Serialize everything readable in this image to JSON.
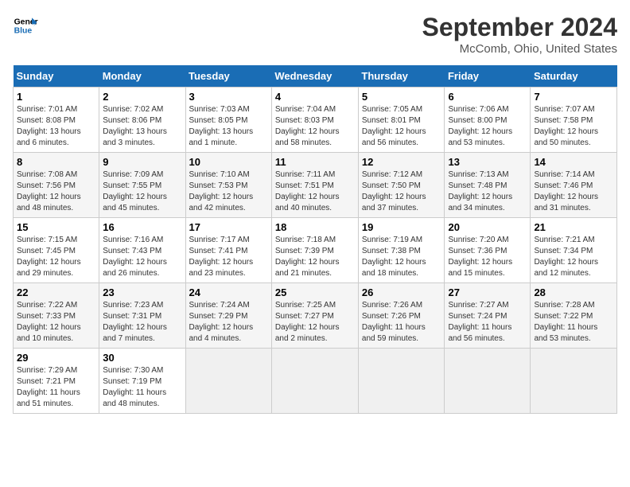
{
  "header": {
    "logo_line1": "General",
    "logo_line2": "Blue",
    "month": "September 2024",
    "location": "McComb, Ohio, United States"
  },
  "weekdays": [
    "Sunday",
    "Monday",
    "Tuesday",
    "Wednesday",
    "Thursday",
    "Friday",
    "Saturday"
  ],
  "weeks": [
    [
      {
        "day": "1",
        "info": "Sunrise: 7:01 AM\nSunset: 8:08 PM\nDaylight: 13 hours\nand 6 minutes."
      },
      {
        "day": "2",
        "info": "Sunrise: 7:02 AM\nSunset: 8:06 PM\nDaylight: 13 hours\nand 3 minutes."
      },
      {
        "day": "3",
        "info": "Sunrise: 7:03 AM\nSunset: 8:05 PM\nDaylight: 13 hours\nand 1 minute."
      },
      {
        "day": "4",
        "info": "Sunrise: 7:04 AM\nSunset: 8:03 PM\nDaylight: 12 hours\nand 58 minutes."
      },
      {
        "day": "5",
        "info": "Sunrise: 7:05 AM\nSunset: 8:01 PM\nDaylight: 12 hours\nand 56 minutes."
      },
      {
        "day": "6",
        "info": "Sunrise: 7:06 AM\nSunset: 8:00 PM\nDaylight: 12 hours\nand 53 minutes."
      },
      {
        "day": "7",
        "info": "Sunrise: 7:07 AM\nSunset: 7:58 PM\nDaylight: 12 hours\nand 50 minutes."
      }
    ],
    [
      {
        "day": "8",
        "info": "Sunrise: 7:08 AM\nSunset: 7:56 PM\nDaylight: 12 hours\nand 48 minutes."
      },
      {
        "day": "9",
        "info": "Sunrise: 7:09 AM\nSunset: 7:55 PM\nDaylight: 12 hours\nand 45 minutes."
      },
      {
        "day": "10",
        "info": "Sunrise: 7:10 AM\nSunset: 7:53 PM\nDaylight: 12 hours\nand 42 minutes."
      },
      {
        "day": "11",
        "info": "Sunrise: 7:11 AM\nSunset: 7:51 PM\nDaylight: 12 hours\nand 40 minutes."
      },
      {
        "day": "12",
        "info": "Sunrise: 7:12 AM\nSunset: 7:50 PM\nDaylight: 12 hours\nand 37 minutes."
      },
      {
        "day": "13",
        "info": "Sunrise: 7:13 AM\nSunset: 7:48 PM\nDaylight: 12 hours\nand 34 minutes."
      },
      {
        "day": "14",
        "info": "Sunrise: 7:14 AM\nSunset: 7:46 PM\nDaylight: 12 hours\nand 31 minutes."
      }
    ],
    [
      {
        "day": "15",
        "info": "Sunrise: 7:15 AM\nSunset: 7:45 PM\nDaylight: 12 hours\nand 29 minutes."
      },
      {
        "day": "16",
        "info": "Sunrise: 7:16 AM\nSunset: 7:43 PM\nDaylight: 12 hours\nand 26 minutes."
      },
      {
        "day": "17",
        "info": "Sunrise: 7:17 AM\nSunset: 7:41 PM\nDaylight: 12 hours\nand 23 minutes."
      },
      {
        "day": "18",
        "info": "Sunrise: 7:18 AM\nSunset: 7:39 PM\nDaylight: 12 hours\nand 21 minutes."
      },
      {
        "day": "19",
        "info": "Sunrise: 7:19 AM\nSunset: 7:38 PM\nDaylight: 12 hours\nand 18 minutes."
      },
      {
        "day": "20",
        "info": "Sunrise: 7:20 AM\nSunset: 7:36 PM\nDaylight: 12 hours\nand 15 minutes."
      },
      {
        "day": "21",
        "info": "Sunrise: 7:21 AM\nSunset: 7:34 PM\nDaylight: 12 hours\nand 12 minutes."
      }
    ],
    [
      {
        "day": "22",
        "info": "Sunrise: 7:22 AM\nSunset: 7:33 PM\nDaylight: 12 hours\nand 10 minutes."
      },
      {
        "day": "23",
        "info": "Sunrise: 7:23 AM\nSunset: 7:31 PM\nDaylight: 12 hours\nand 7 minutes."
      },
      {
        "day": "24",
        "info": "Sunrise: 7:24 AM\nSunset: 7:29 PM\nDaylight: 12 hours\nand 4 minutes."
      },
      {
        "day": "25",
        "info": "Sunrise: 7:25 AM\nSunset: 7:27 PM\nDaylight: 12 hours\nand 2 minutes."
      },
      {
        "day": "26",
        "info": "Sunrise: 7:26 AM\nSunset: 7:26 PM\nDaylight: 11 hours\nand 59 minutes."
      },
      {
        "day": "27",
        "info": "Sunrise: 7:27 AM\nSunset: 7:24 PM\nDaylight: 11 hours\nand 56 minutes."
      },
      {
        "day": "28",
        "info": "Sunrise: 7:28 AM\nSunset: 7:22 PM\nDaylight: 11 hours\nand 53 minutes."
      }
    ],
    [
      {
        "day": "29",
        "info": "Sunrise: 7:29 AM\nSunset: 7:21 PM\nDaylight: 11 hours\nand 51 minutes."
      },
      {
        "day": "30",
        "info": "Sunrise: 7:30 AM\nSunset: 7:19 PM\nDaylight: 11 hours\nand 48 minutes."
      },
      {
        "day": "",
        "info": ""
      },
      {
        "day": "",
        "info": ""
      },
      {
        "day": "",
        "info": ""
      },
      {
        "day": "",
        "info": ""
      },
      {
        "day": "",
        "info": ""
      }
    ]
  ]
}
